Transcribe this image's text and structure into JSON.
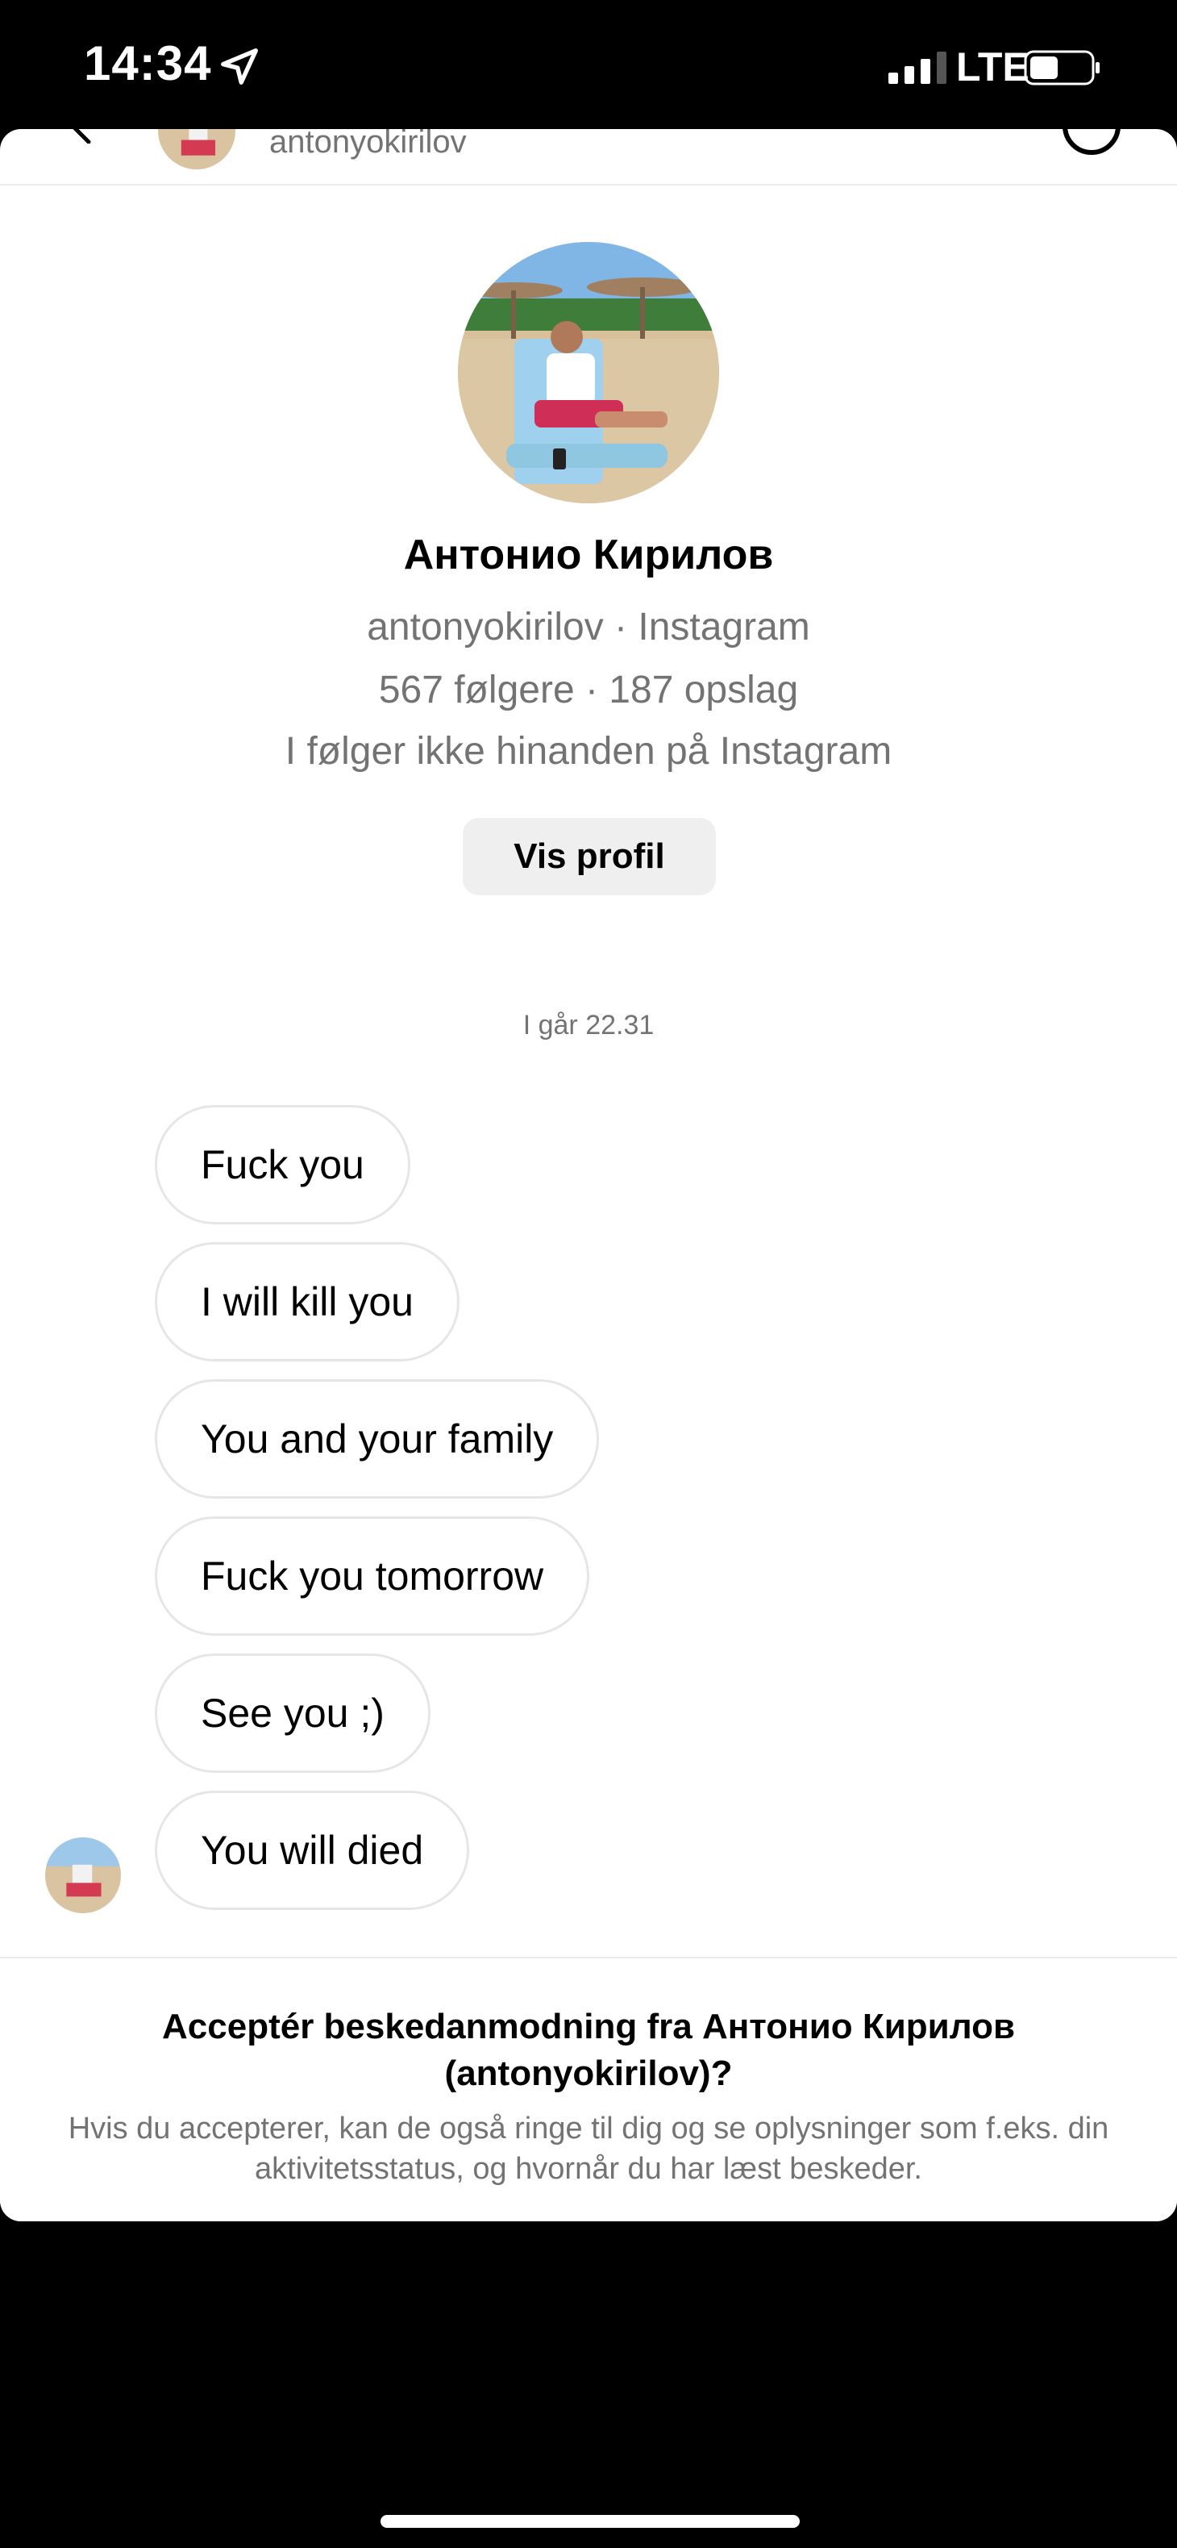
{
  "status_bar": {
    "time": "14:34",
    "network": "LTE"
  },
  "header": {
    "username": "antonyokirilov"
  },
  "profile": {
    "name": "Антонио Кирилов",
    "handle_line": "antonyokirilov · Instagram",
    "stats_line": "567 følgere · 187 opslag",
    "relation_line": "I følger ikke hinanden på Instagram",
    "view_profile_label": "Vis profil"
  },
  "timestamp": "I går 22.31",
  "messages": [
    {
      "text": "Fuck you"
    },
    {
      "text": "I will kill you"
    },
    {
      "text": "You and your family"
    },
    {
      "text": "Fuck you tomorrow"
    },
    {
      "text": "See you ;)"
    },
    {
      "text": "You will died"
    }
  ],
  "request": {
    "title": "Acceptér beskedanmodning fra Антонио Кирилов (antonyokirilov)?",
    "body": "Hvis du accepterer, kan de også ringe til dig og se oplysninger som f.eks. din aktivitetsstatus, og hvornår du har læst beskeder."
  },
  "colors": {
    "background": "#000000",
    "sheet": "#ffffff",
    "secondary_text": "#737373",
    "bubble_border": "#e6e6e6",
    "button_bg": "#efefef"
  }
}
